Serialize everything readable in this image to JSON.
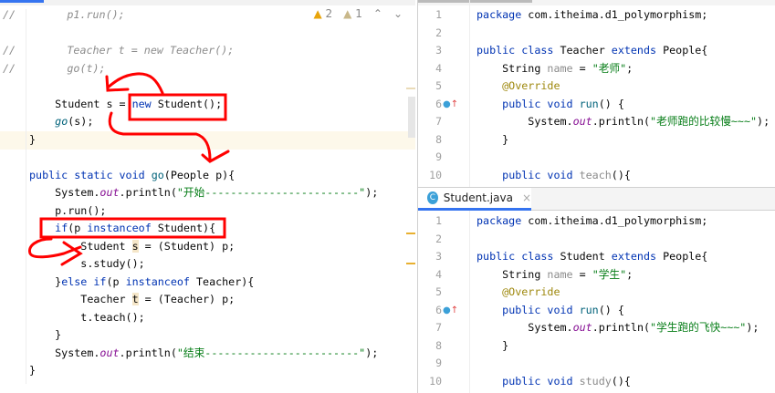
{
  "editor_left": {
    "inspections": {
      "warnings": "2",
      "weak_warnings": "1"
    },
    "lines": [
      [
        [
          "//        p1.run();",
          "cm"
        ]
      ],
      [],
      [
        [
          "//        Teacher t = new Teacher();",
          "cm"
        ]
      ],
      [
        [
          "//        go(t);",
          "cm"
        ]
      ],
      [],
      [
        [
          "    Student s = ",
          ""
        ],
        [
          "new",
          "kw"
        ],
        [
          " Student();",
          ""
        ]
      ],
      [
        [
          "    ",
          ""
        ],
        [
          "go",
          "mth"
        ],
        [
          "(s);",
          ""
        ]
      ],
      [
        [
          "}",
          ""
        ]
      ],
      [],
      [
        [
          "public static void ",
          "kw"
        ],
        [
          "go",
          "fn"
        ],
        [
          "(People p){",
          ""
        ]
      ],
      [
        [
          "    System.",
          ""
        ],
        [
          "out",
          "fld"
        ],
        [
          ".println(",
          ""
        ],
        [
          "\"开始------------------------\"",
          "st"
        ],
        [
          ");",
          ""
        ]
      ],
      [
        [
          "    p.run();",
          ""
        ]
      ],
      [
        [
          "    ",
          ""
        ],
        [
          "if",
          "kw"
        ],
        [
          "(p ",
          ""
        ],
        [
          "instanceof",
          "kw"
        ],
        [
          " Student){",
          ""
        ]
      ],
      [
        [
          "        Student ",
          ""
        ],
        [
          "s",
          "hl"
        ],
        [
          " = (Student) p;",
          ""
        ]
      ],
      [
        [
          "        s.study();",
          ""
        ]
      ],
      [
        [
          "    }",
          ""
        ],
        [
          "else if",
          "kw"
        ],
        [
          "(p ",
          ""
        ],
        [
          "instanceof",
          "kw"
        ],
        [
          " Teacher){",
          ""
        ]
      ],
      [
        [
          "        Teacher ",
          ""
        ],
        [
          "t",
          "hl"
        ],
        [
          " = (Teacher) p;",
          ""
        ]
      ],
      [
        [
          "        t.teach();",
          ""
        ]
      ],
      [
        [
          "    }",
          ""
        ]
      ],
      [
        [
          "    System.",
          ""
        ],
        [
          "out",
          "fld"
        ],
        [
          ".println(",
          ""
        ],
        [
          "\"结束------------------------\"",
          "st"
        ],
        [
          ");",
          ""
        ]
      ],
      [
        [
          "}",
          ""
        ]
      ]
    ]
  },
  "editor_teacher": {
    "lines": [
      [
        [
          "package ",
          "kw"
        ],
        [
          "com.itheima.d1_polymorphism;",
          ""
        ]
      ],
      [],
      [
        [
          "public class ",
          "kw"
        ],
        [
          "Teacher ",
          ""
        ],
        [
          "extends ",
          "kw"
        ],
        [
          "People{",
          ""
        ]
      ],
      [
        [
          "    String ",
          ""
        ],
        [
          "name",
          "gr"
        ],
        [
          " = ",
          ""
        ],
        [
          "\"老师\"",
          "st"
        ],
        [
          ";",
          ""
        ]
      ],
      [
        [
          "    @Override",
          "an"
        ]
      ],
      [
        [
          "    ",
          ""
        ],
        [
          "public void ",
          "kw"
        ],
        [
          "run",
          "fn"
        ],
        [
          "() {",
          ""
        ]
      ],
      [
        [
          "        System.",
          ""
        ],
        [
          "out",
          "fld"
        ],
        [
          ".println(",
          ""
        ],
        [
          "\"老师跑的比较慢~~~\"",
          "st"
        ],
        [
          ");",
          ""
        ]
      ],
      [
        [
          "    }",
          ""
        ]
      ],
      [],
      [
        [
          "    ",
          ""
        ],
        [
          "public void ",
          "kw"
        ],
        [
          "teach",
          "gr"
        ],
        [
          "(){",
          ""
        ]
      ]
    ]
  },
  "tab": {
    "label": "Student.java",
    "icon": "C",
    "close": "×"
  },
  "editor_student": {
    "lines": [
      [
        [
          "package ",
          "kw"
        ],
        [
          "com.itheima.d1_polymorphism;",
          ""
        ]
      ],
      [],
      [
        [
          "public class ",
          "kw"
        ],
        [
          "Student ",
          ""
        ],
        [
          "extends ",
          "kw"
        ],
        [
          "People{",
          ""
        ]
      ],
      [
        [
          "    String ",
          ""
        ],
        [
          "name",
          "gr"
        ],
        [
          " = ",
          ""
        ],
        [
          "\"学生\"",
          "st"
        ],
        [
          ";",
          ""
        ]
      ],
      [
        [
          "    @Override",
          "an"
        ]
      ],
      [
        [
          "    ",
          ""
        ],
        [
          "public void ",
          "kw"
        ],
        [
          "run",
          "fn"
        ],
        [
          "() {",
          ""
        ]
      ],
      [
        [
          "        System.",
          ""
        ],
        [
          "out",
          "fld"
        ],
        [
          ".println(",
          ""
        ],
        [
          "\"学生跑的飞快~~~\"",
          "st"
        ],
        [
          ");",
          ""
        ]
      ],
      [
        [
          "    }",
          ""
        ]
      ],
      [],
      [
        [
          "    ",
          ""
        ],
        [
          "public void ",
          "kw"
        ],
        [
          "study",
          "gr"
        ],
        [
          "(){",
          ""
        ]
      ]
    ]
  },
  "annotation_color": "#ff0000"
}
